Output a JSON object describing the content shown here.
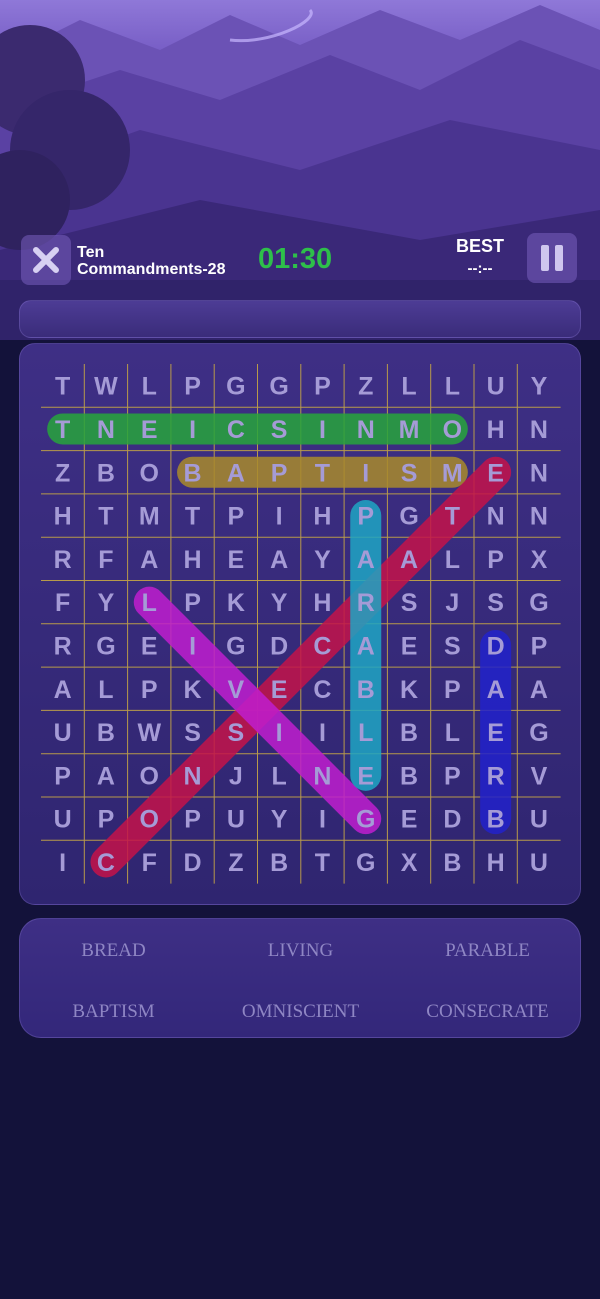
{
  "header": {
    "title_line1": "Ten",
    "title_line2": "Commandments-28",
    "timer": "01:30",
    "best_label": "BEST",
    "best_value": "--:--",
    "close_icon": "close-icon",
    "pause_icon": "pause-icon"
  },
  "grid": [
    "TWLPGGPZLLUY",
    "TNEICSINMOHN",
    "ZBOBAPTISMEN",
    "HTMTPIHPGTNN",
    "RFAHEAYAALPX",
    "FYLPKYHRSJSG",
    "RGEIGDCAESDP",
    "ALPKVECBKPAA",
    "UBWSSIILBLEG",
    "PAONJLNEBPRV",
    "UPOPUYIGEDBU",
    "ICFDZBTGXBHU"
  ],
  "found_words": [
    {
      "word": "OMNISCIENT",
      "start": [
        1,
        9
      ],
      "end": [
        1,
        0
      ],
      "color": "#27a53c"
    },
    {
      "word": "BAPTISM",
      "start": [
        2,
        3
      ],
      "end": [
        2,
        9
      ],
      "color": "#a98a2c"
    },
    {
      "word": "CONSECRATE",
      "start": [
        11,
        1
      ],
      "end": [
        2,
        10
      ],
      "color": "#c4134a"
    },
    {
      "word": "LIVING",
      "start": [
        5,
        2
      ],
      "end": [
        10,
        7
      ],
      "color": "#c01ecf"
    },
    {
      "word": "PARABLE",
      "start": [
        3,
        7
      ],
      "end": [
        9,
        7
      ],
      "color": "#1fa6c4"
    },
    {
      "word": "BREAD",
      "start": [
        10,
        10
      ],
      "end": [
        6,
        10
      ],
      "color": "#2222cc"
    }
  ],
  "word_list": [
    "BREAD",
    "LIVING",
    "PARABLE",
    "BAPTISM",
    "OMNISCIENT",
    "CONSECRATE"
  ]
}
